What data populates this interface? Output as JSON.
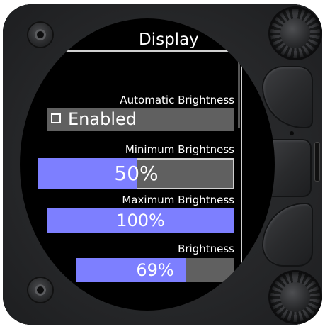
{
  "screen": {
    "title": "Display",
    "automatic_brightness": {
      "label": "Automatic Brightness",
      "checkbox_label": "Enabled",
      "checked": false
    },
    "minimum_brightness": {
      "label": "Minimum Brightness",
      "value_text": "50%",
      "level": 0.5
    },
    "maximum_brightness": {
      "label": "Maximum Brightness",
      "value_text": "100%",
      "level": 1.0
    },
    "brightness": {
      "label": "Brightness",
      "value_text": "69%",
      "level": 0.69
    }
  },
  "colors": {
    "fill": "#7d7fff",
    "field_bg": "#606060",
    "screen_bg": "#000000",
    "text": "#ffffff"
  },
  "icons": [
    "screw-icon",
    "rotary-knob-icon",
    "checkbox-icon"
  ]
}
